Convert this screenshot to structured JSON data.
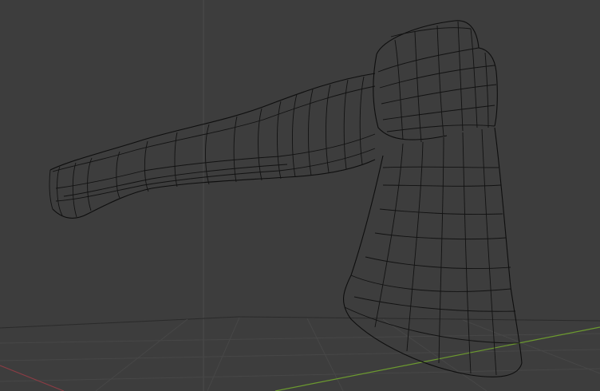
{
  "viewport": {
    "mode": "wireframe",
    "object": "axe",
    "background_color": "#3d3d3d",
    "wire_color": "#121212",
    "axis_colors": {
      "x": "#8a3c44",
      "y": "#6c9a2f"
    }
  }
}
